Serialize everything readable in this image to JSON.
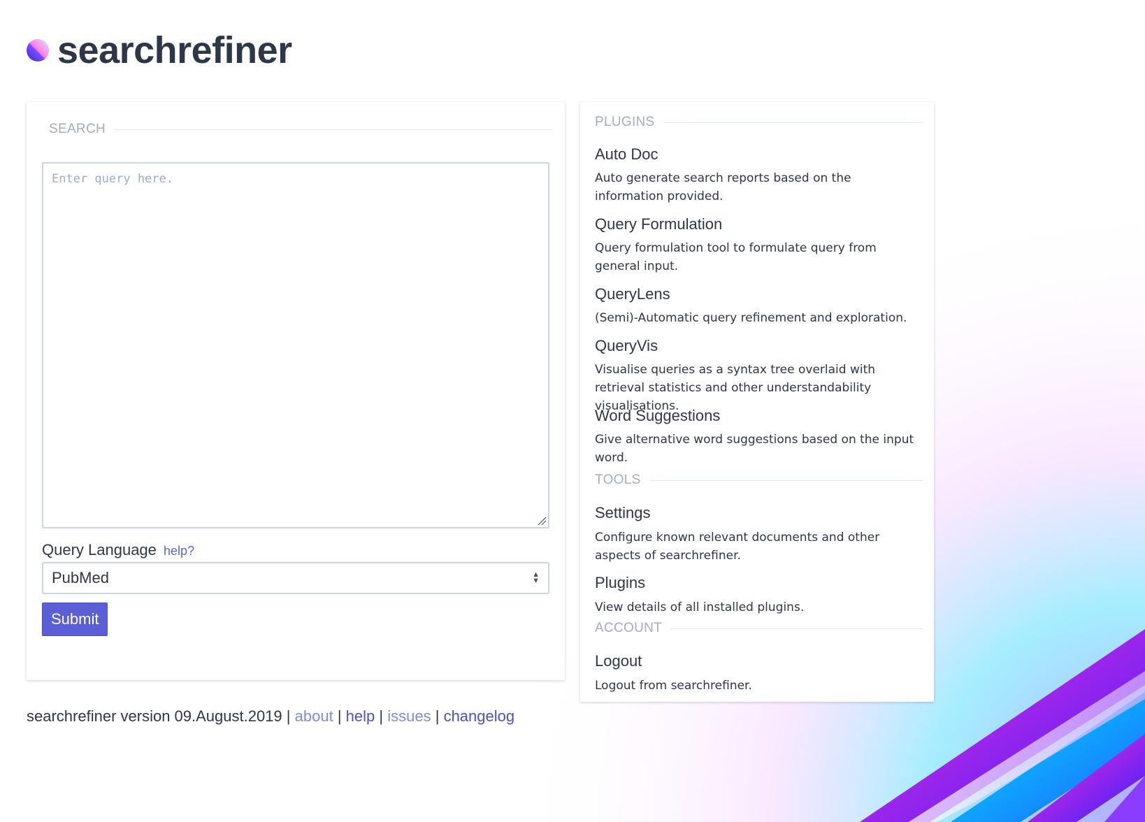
{
  "app": {
    "title": "searchrefiner"
  },
  "search": {
    "legend": "SEARCH",
    "query_placeholder": "Enter query here.",
    "query_value": "",
    "query_language_label": "Query Language",
    "query_language_help": "help?",
    "query_language_value": "PubMed",
    "submit_label": "Submit"
  },
  "sections": {
    "plugins_legend": "PLUGINS",
    "tools_legend": "TOOLS",
    "account_legend": "ACCOUNT"
  },
  "plugins": [
    {
      "title": "Auto Doc",
      "desc": "Auto generate search reports based on the information provided."
    },
    {
      "title": "Query Formulation",
      "desc": "Query formulation tool to formulate query from general input."
    },
    {
      "title": "QueryLens",
      "desc": "(Semi)-Automatic query refinement and exploration."
    },
    {
      "title": "QueryVis",
      "desc": "Visualise queries as a syntax tree overlaid with retrieval statistics and other understandability visualisations."
    },
    {
      "title": "Word Suggestions",
      "desc": "Give alternative word suggestions based on the input word."
    }
  ],
  "tools": [
    {
      "title": "Settings",
      "desc": "Configure known relevant documents and other aspects of searchrefiner."
    },
    {
      "title": "Plugins",
      "desc": "View details of all installed plugins."
    }
  ],
  "account": [
    {
      "title": "Logout",
      "desc": "Logout from searchrefiner."
    }
  ],
  "footer": {
    "version_text": "searchrefiner version 09.August.2019",
    "sep": "|",
    "about": "about",
    "help": "help",
    "issues": "issues",
    "changelog": "changelog"
  },
  "colors": {
    "accent": "#5a5fd6",
    "link_light": "#7f8be0",
    "link_dark": "#4c51bf",
    "muted": "#a0aec0",
    "text": "#2d3748"
  },
  "icons": {
    "logo": "searchrefiner-logo-icon",
    "select": "select-arrows-icon",
    "grip": "resize-grip-icon"
  }
}
